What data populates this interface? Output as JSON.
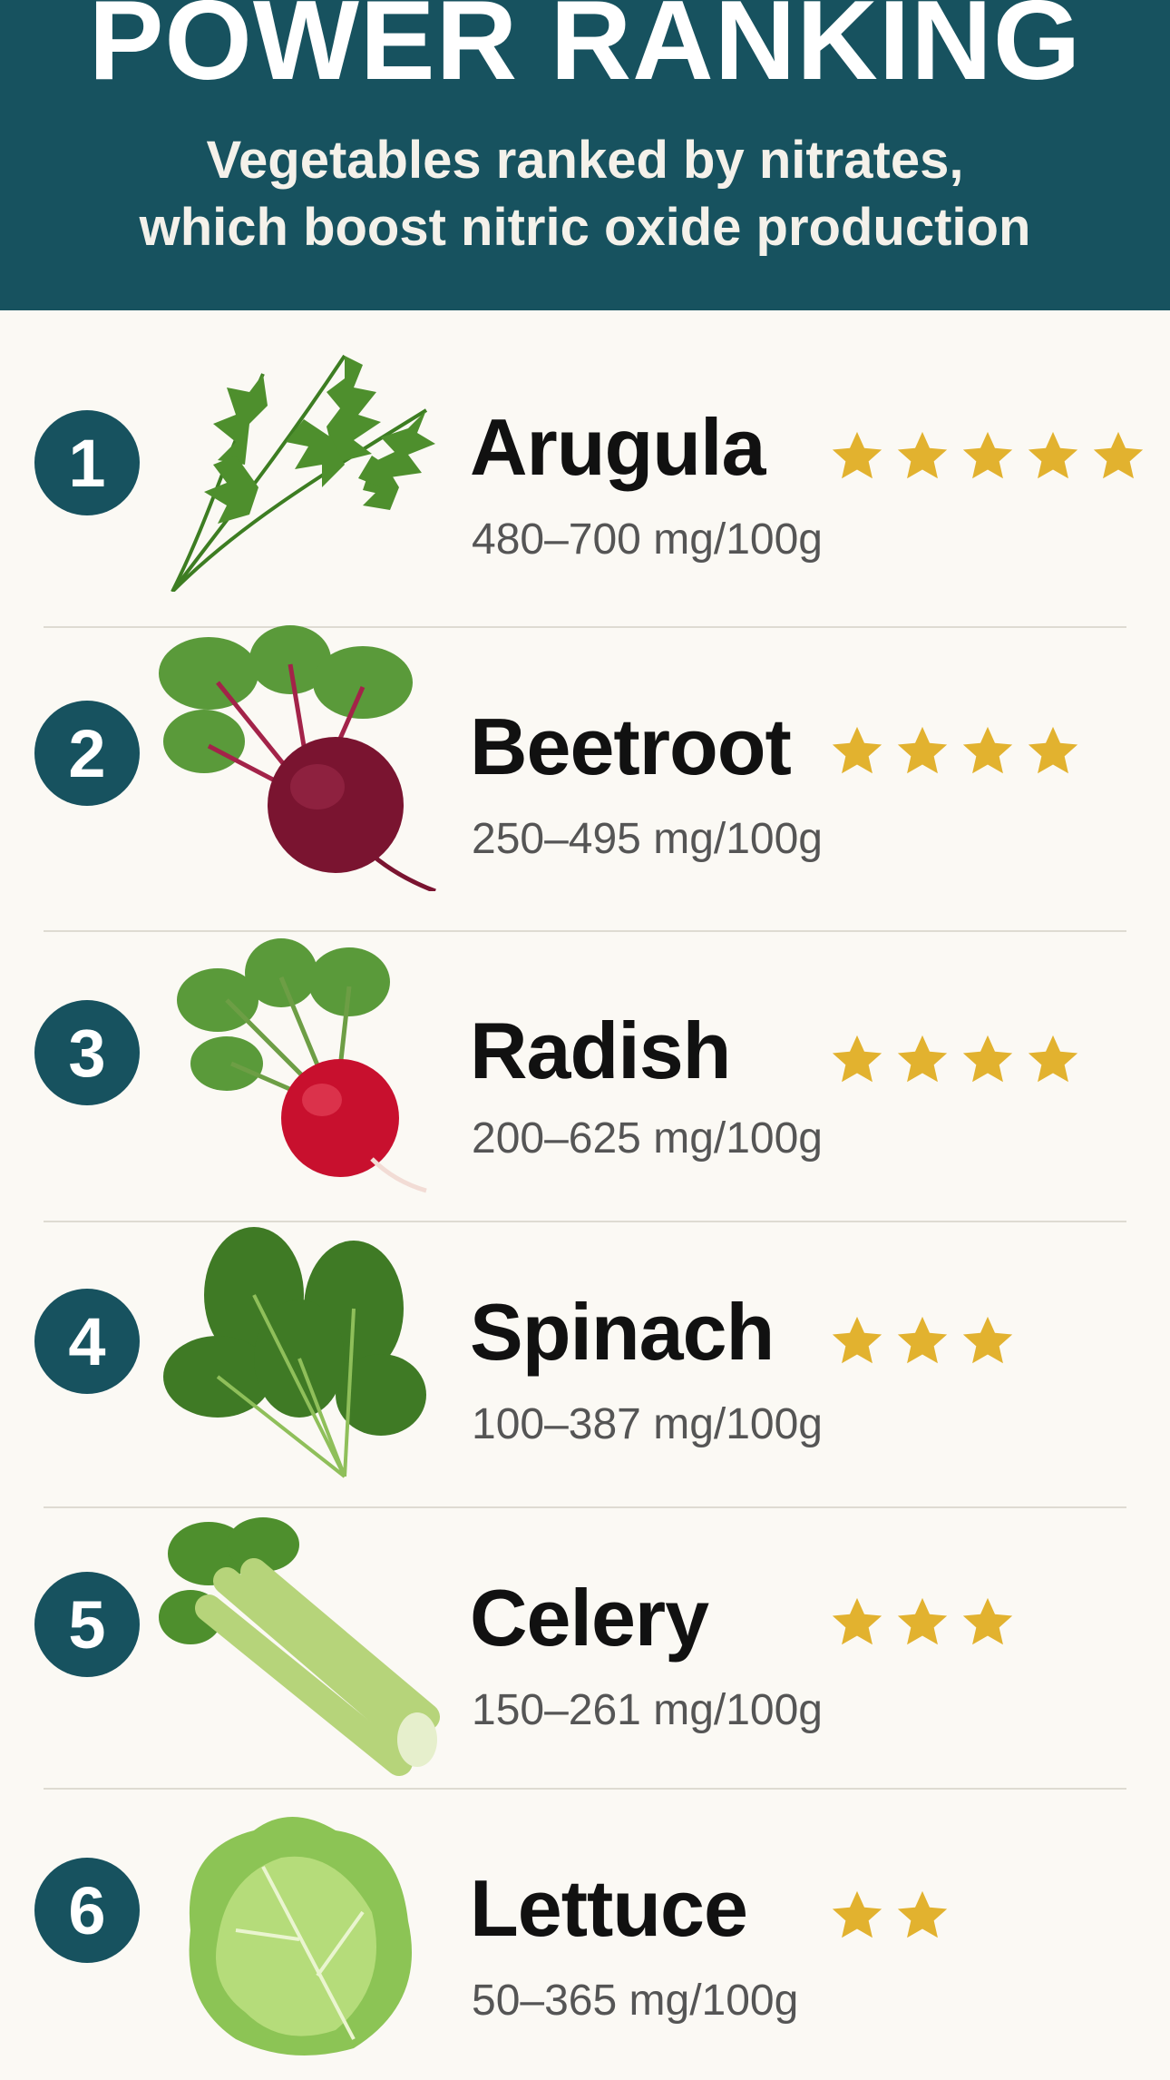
{
  "header": {
    "title": "POWER RANKING",
    "subtitle_line1": "Vegetables ranked by nitrates,",
    "subtitle_line2": "which boost nitric oxide production"
  },
  "colors": {
    "header_bg": "#17525f",
    "badge_bg": "#17525f",
    "star": "#e2b22f",
    "page_bg": "#fbf9f4"
  },
  "items": [
    {
      "rank": "1",
      "name": "Arugula",
      "amount": "480–700 mg/100g",
      "stars": 5,
      "icon": "arugula-icon"
    },
    {
      "rank": "2",
      "name": "Beetroot",
      "amount": "250–495 mg/100g",
      "stars": 4,
      "icon": "beetroot-icon"
    },
    {
      "rank": "3",
      "name": "Radish",
      "amount": "200–625 mg/100g",
      "stars": 4,
      "icon": "radish-icon"
    },
    {
      "rank": "4",
      "name": "Spinach",
      "amount": "100–387 mg/100g",
      "stars": 3,
      "icon": "spinach-icon"
    },
    {
      "rank": "5",
      "name": "Celery",
      "amount": "150–261 mg/100g",
      "stars": 3,
      "icon": "celery-icon"
    },
    {
      "rank": "6",
      "name": "Lettuce",
      "amount": "50–365 mg/100g",
      "stars": 2,
      "icon": "lettuce-icon"
    }
  ]
}
